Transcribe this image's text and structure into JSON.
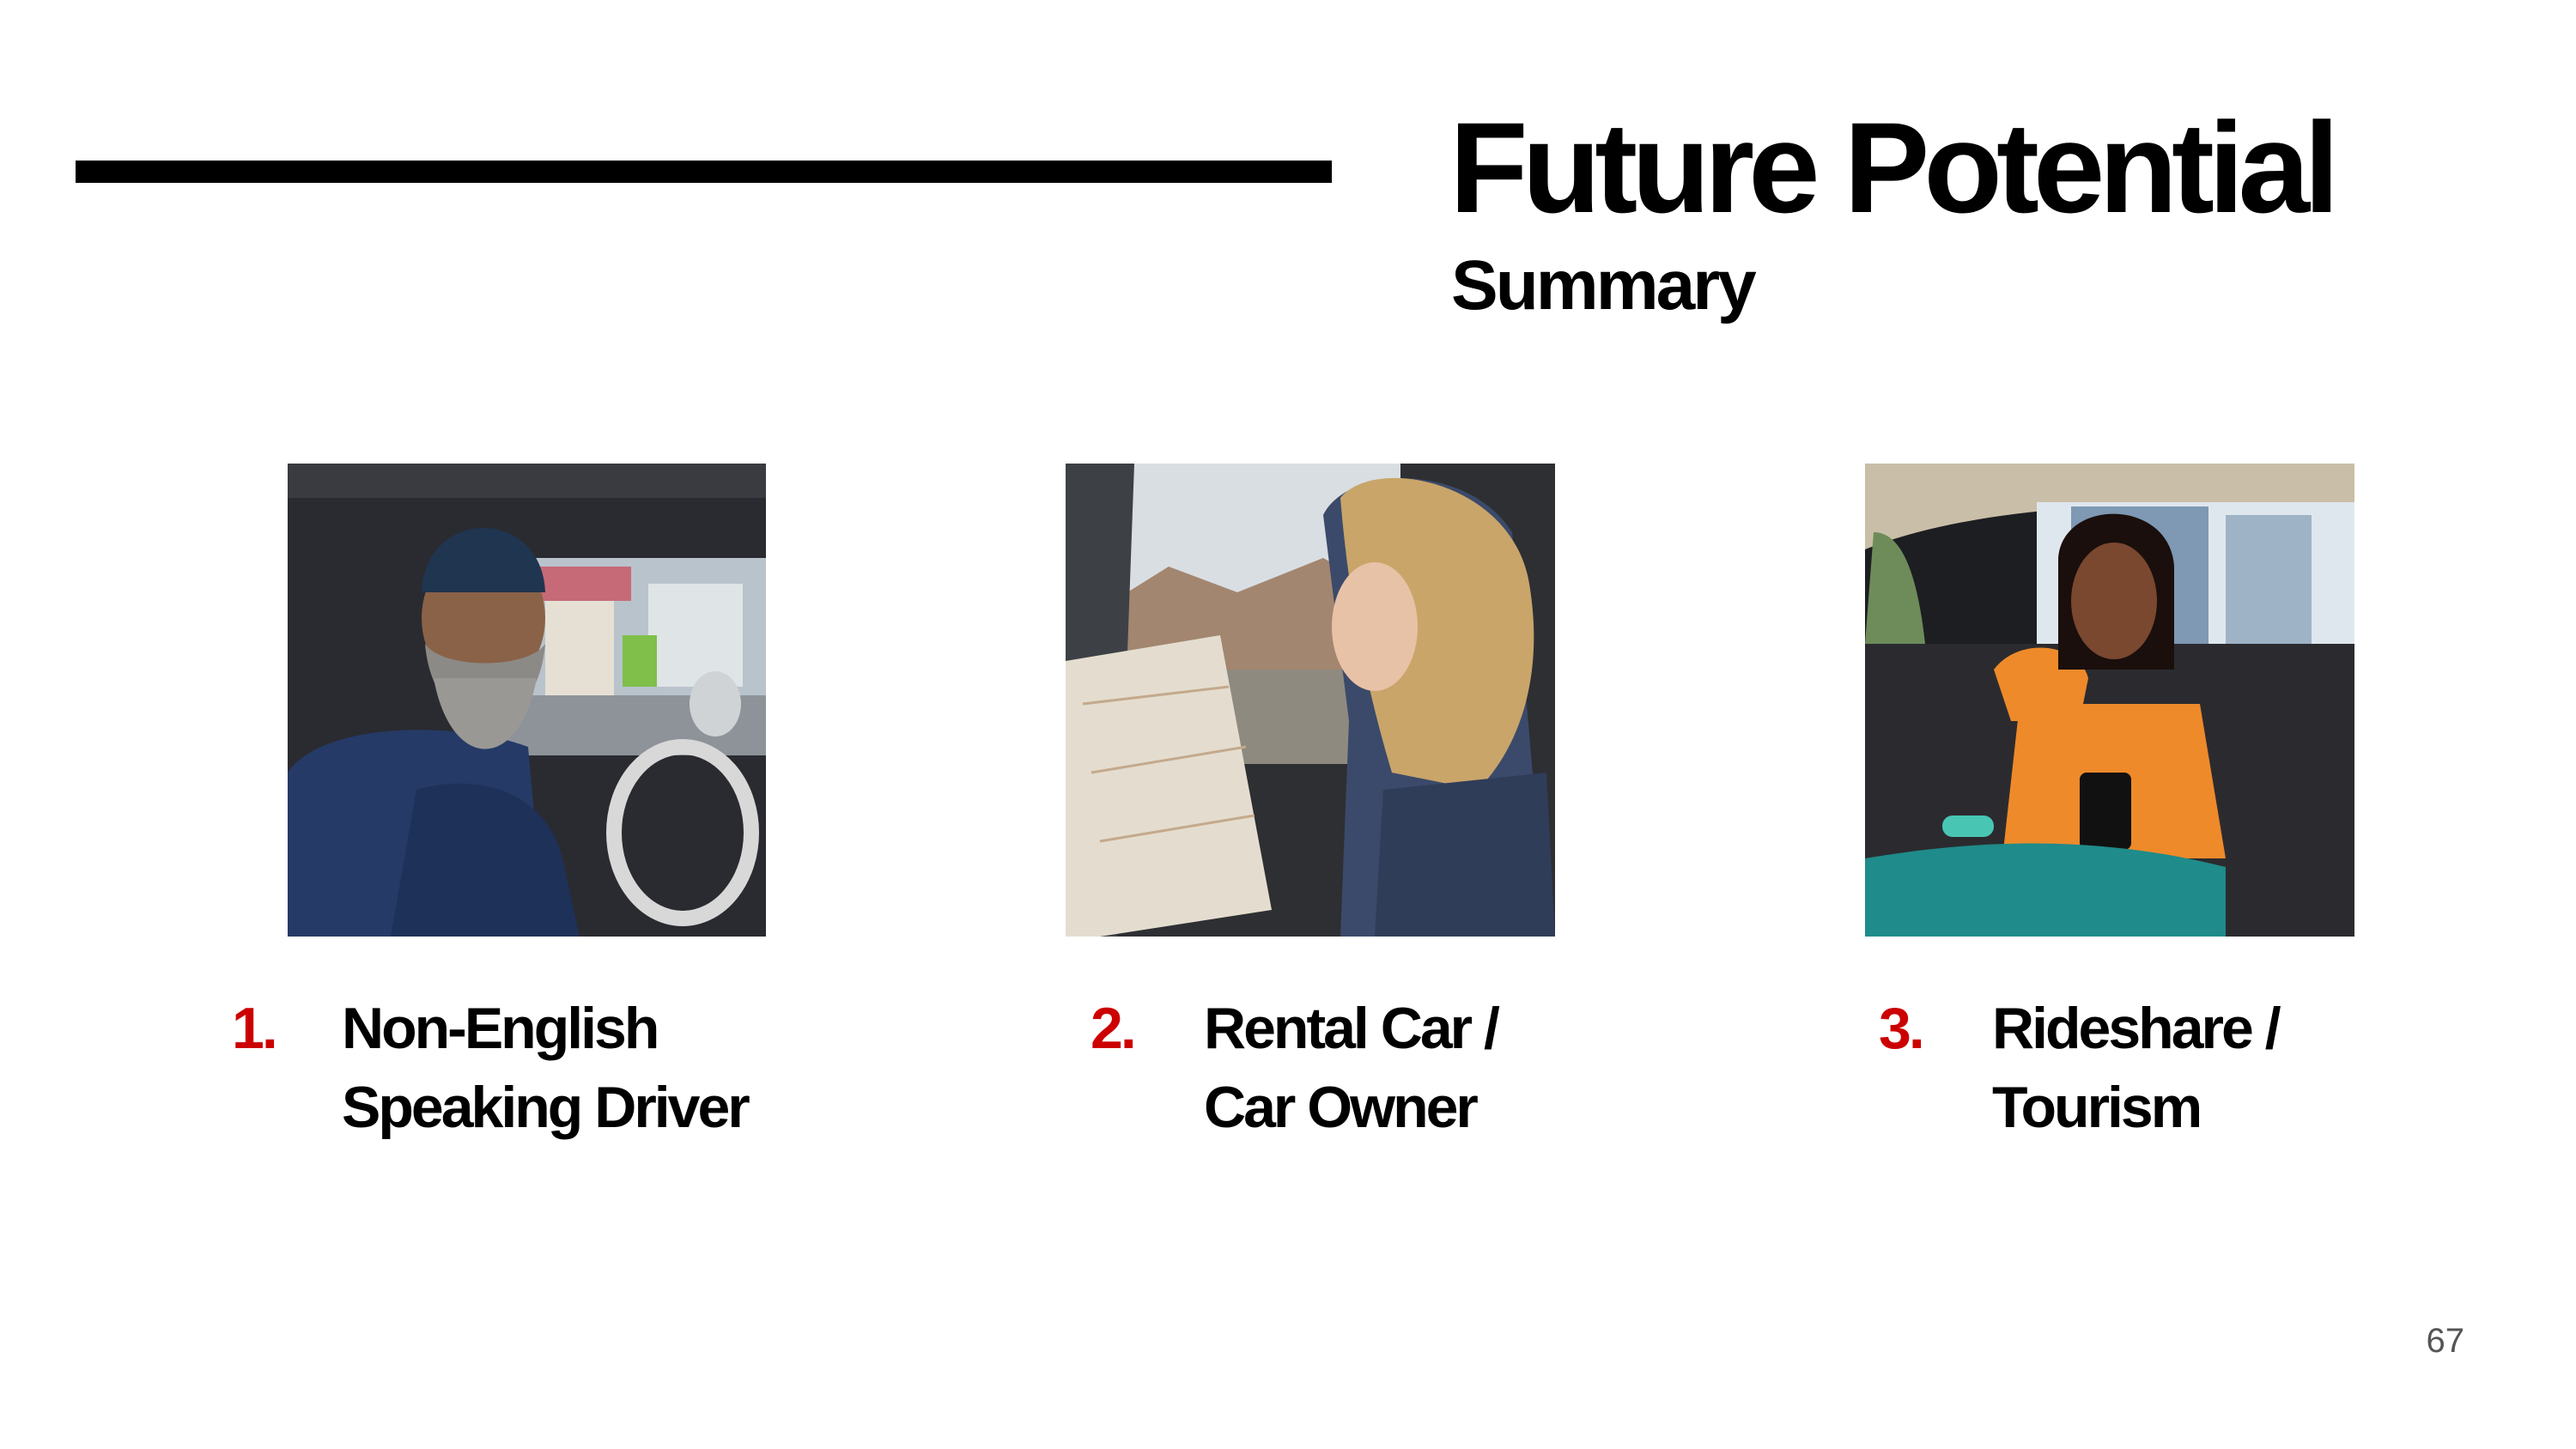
{
  "header": {
    "title": "Future Potential",
    "subtitle": "Summary"
  },
  "items": [
    {
      "number": "1.",
      "lines": [
        "Non-English",
        "Speaking Driver"
      ],
      "image": "photo of bearded man in beanie sitting in truck cab"
    },
    {
      "number": "2.",
      "lines": [
        "Rental Car /",
        "Car Owner"
      ],
      "image": "photo of woman reading a paper map in car"
    },
    {
      "number": "3.",
      "lines": [
        "Rideshare /",
        "Tourism"
      ],
      "image": "photo of smiling woman in orange top holding phone in back seat"
    }
  ],
  "page_number": "67",
  "colors": {
    "accent": "#cc0000",
    "text": "#000000",
    "background": "#ffffff",
    "page_number": "#555555"
  }
}
